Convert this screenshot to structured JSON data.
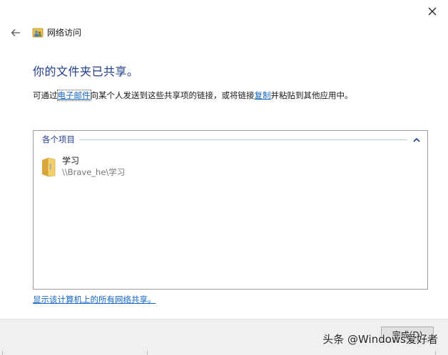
{
  "window": {
    "title": "网络访问",
    "icons": {
      "close": "close-icon",
      "back": "back-arrow-icon",
      "app": "network-share-icon"
    }
  },
  "main": {
    "heading": "你的文件夹已共享。",
    "description": {
      "part1": "可通过",
      "email_link": "电子邮件",
      "part2": "向某个人发送到这些共享项的链接，或将链接",
      "copy_link": "复制",
      "part3": "并粘贴到其他应用中。"
    }
  },
  "items_panel": {
    "group_label": "各个项目",
    "items": [
      {
        "name": "学习",
        "path": "\\\\Brave_he\\学习",
        "icon": "folder-icon"
      }
    ]
  },
  "all_shares_link": "显示该计算机上的所有网络共享。",
  "footer": {
    "finish_label": "完成(D)"
  },
  "watermark": "头条 @Windows爱好者",
  "colors": {
    "heading": "#1e3c8c",
    "link": "#1565c0",
    "footer_bg": "#f0f0f0"
  }
}
